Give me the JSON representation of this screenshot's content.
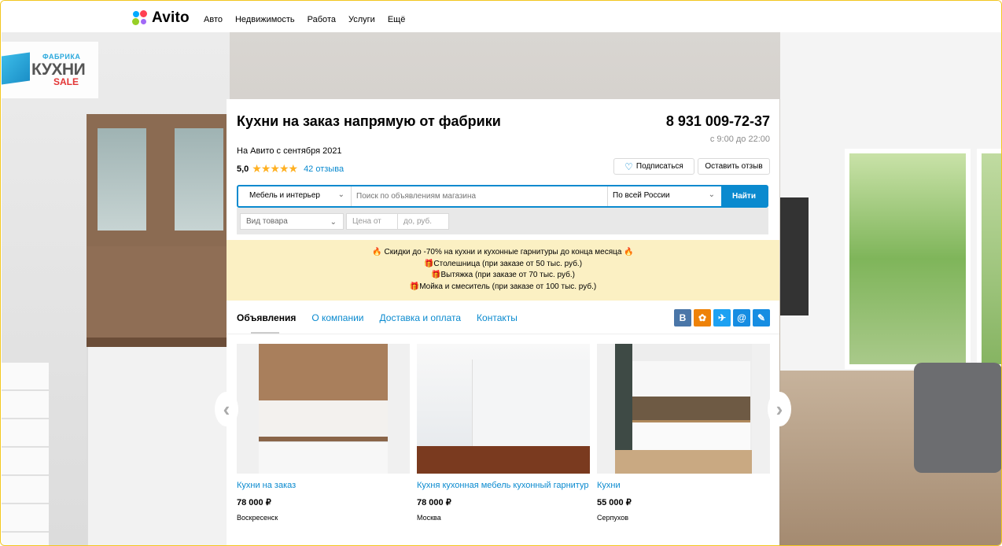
{
  "nav": {
    "logo": "Avito",
    "links": [
      "Авто",
      "Недвижимость",
      "Работа",
      "Услуги",
      "Ещё"
    ]
  },
  "brand": {
    "line1": "ФАБРИКА",
    "line2": "КУХНИ",
    "line3": "SALE"
  },
  "shop": {
    "title": "Кухни на заказ напрямую от фабрики",
    "phone": "8 931 009-72-37",
    "hours": "с 9:00 до 22:00",
    "since": "На Авито с сентября 2021",
    "rating": "5,0",
    "stars": "★★★★★",
    "reviews": "42 отзыва",
    "subscribe": "Подписаться",
    "leave_review": "Оставить отзыв"
  },
  "search": {
    "category": "Мебель и интерьер",
    "placeholder": "Поиск по объявлениям магазина",
    "region": "По всей России",
    "button": "Найти",
    "kind": "Вид товара",
    "price_from": "Цена от",
    "price_to": "до, руб."
  },
  "promo": [
    "🔥 Скидки до -70% на кухни и кухонные гарнитуры до конца месяца 🔥",
    "🎁Столешница (при заказе от 50 тыс. руб.)",
    "🎁Вытяжка (при заказе от 70 тыс. руб.)",
    "🎁Мойка и смеситель (при заказе от 100 тыс. руб.)"
  ],
  "tabs": [
    "Объявления",
    "О компании",
    "Доставка и оплата",
    "Контакты"
  ],
  "social": [
    "В",
    "ok",
    "tw",
    "@",
    "more"
  ],
  "listings": [
    {
      "name": "Кухни на заказ",
      "price": "78 000 ₽",
      "location": "Воскресенск"
    },
    {
      "name": "Кухня кухонная мебель кухонный гарнитур",
      "price": "78 000 ₽",
      "location": "Москва"
    },
    {
      "name": "Кухни",
      "price": "55 000 ₽",
      "location": "Серпухов"
    }
  ],
  "colors": {
    "accent": "#0a8acf",
    "promo_bg": "#fbf0c3",
    "star": "#ffb021"
  }
}
